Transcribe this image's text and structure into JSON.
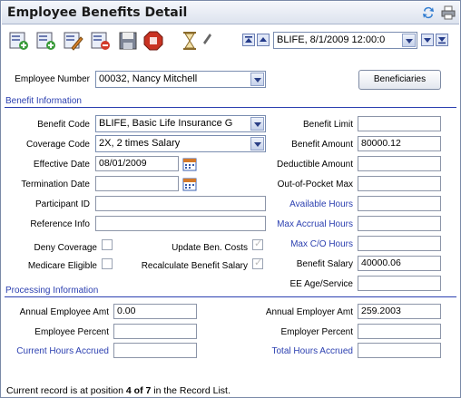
{
  "window": {
    "title": "Employee Benefits Detail"
  },
  "navigator": {
    "record_value": "BLIFE, 8/1/2009 12:00:0"
  },
  "employee": {
    "label": "Employee Number",
    "value": "00032, Nancy Mitchell",
    "beneficiaries_label": "Beneficiaries"
  },
  "benefit_info": {
    "section_label": "Benefit Information",
    "benefit_code_label": "Benefit Code",
    "benefit_code_value": "BLIFE, Basic Life Insurance G",
    "coverage_code_label": "Coverage Code",
    "coverage_code_value": "2X, 2 times Salary",
    "effective_date_label": "Effective Date",
    "effective_date_value": "08/01/2009",
    "termination_date_label": "Termination Date",
    "termination_date_value": "",
    "participant_id_label": "Participant ID",
    "participant_id_value": "",
    "reference_info_label": "Reference Info",
    "reference_info_value": "",
    "deny_coverage_label": "Deny Coverage",
    "medicare_eligible_label": "Medicare Eligible",
    "update_ben_costs_label": "Update Ben. Costs",
    "recalculate_label": "Recalculate Benefit Salary",
    "benefit_limit_label": "Benefit Limit",
    "benefit_limit_value": "",
    "benefit_amount_label": "Benefit Amount",
    "benefit_amount_value": "80000.12",
    "deductible_amount_label": "Deductible Amount",
    "deductible_amount_value": "",
    "oop_max_label": "Out-of-Pocket Max",
    "oop_max_value": "",
    "available_hours_label": "Available Hours",
    "available_hours_value": "",
    "max_accrual_hours_label": "Max Accrual Hours",
    "max_accrual_hours_value": "",
    "max_co_hours_label": "Max C/O Hours",
    "max_co_hours_value": "",
    "benefit_salary_label": "Benefit Salary",
    "benefit_salary_value": "40000.06",
    "ee_age_service_label": "EE Age/Service"
  },
  "processing_info": {
    "section_label": "Processing Information",
    "annual_employee_amt_label": "Annual Employee Amt",
    "annual_employee_amt_value": "0.00",
    "employee_percent_label": "Employee Percent",
    "employee_percent_value": "",
    "current_hours_accrued_label": "Current Hours Accrued",
    "current_hours_accrued_value": "",
    "annual_employer_amt_label": "Annual Employer Amt",
    "annual_employer_amt_value": "259.2003",
    "employer_percent_label": "Employer Percent",
    "employer_percent_value": "",
    "total_hours_accrued_label": "Total Hours Accrued",
    "total_hours_accrued_value": ""
  },
  "status": {
    "prefix": "Current record is at position ",
    "position": "4 of 7",
    "suffix": " in the Record List."
  },
  "colors": {
    "link_blue": "#2b3fb0",
    "title_gradient_top": "#f4f6fb"
  }
}
